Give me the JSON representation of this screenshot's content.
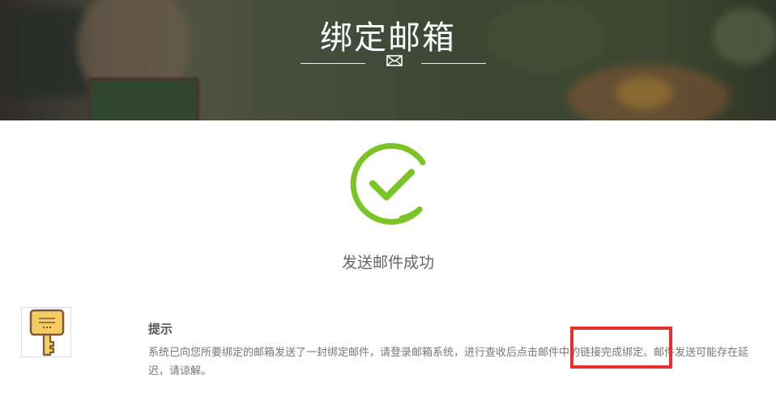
{
  "banner": {
    "title": "绑定邮箱",
    "icon": "envelope-icon"
  },
  "status": {
    "icon": "check-circle-icon",
    "icon_color": "#7ac426",
    "message": "发送邮件成功"
  },
  "tip": {
    "icon": "key-icon",
    "title": "提示",
    "text": "系统已向您所要绑定的邮箱发送了一封绑定邮件，请登录邮箱系统，进行查收后点击邮件中的链接完成绑定。邮件发送可能存在延迟，请谅解。"
  },
  "annotation": {
    "highlight_color": "#e8302e"
  }
}
